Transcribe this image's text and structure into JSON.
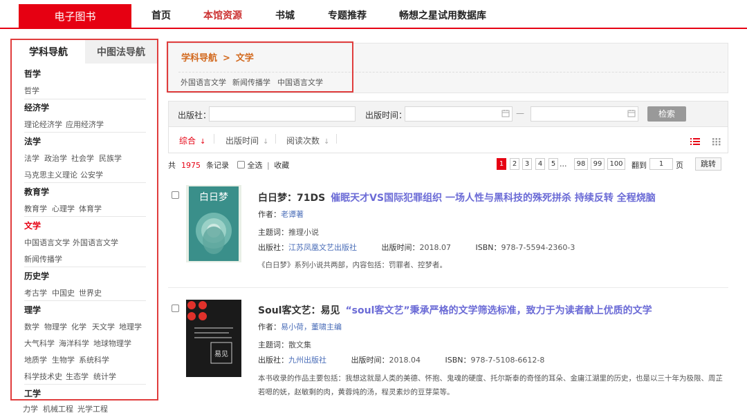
{
  "topnav": {
    "brand": "电子图书",
    "items": [
      "首页",
      "本馆资源",
      "书城",
      "专题推荐",
      "畅想之星试用数据库"
    ]
  },
  "sidebar": {
    "tabs": [
      "学科导航",
      "中图法导航"
    ],
    "categories": [
      {
        "title": "哲学",
        "subs": [
          "哲学"
        ]
      },
      {
        "title": "经济学",
        "subs": [
          "理论经济学",
          "应用经济学"
        ]
      },
      {
        "title": "法学",
        "subs": [
          "法学",
          "政治学",
          "社会学",
          "民族学",
          "马克思主义理论",
          "公安学"
        ]
      },
      {
        "title": "教育学",
        "subs": [
          "教育学",
          "心理学",
          "体育学"
        ]
      },
      {
        "title": "文学",
        "subs": [
          "中国语言文学",
          "外国语言文学",
          "新闻传播学"
        ]
      },
      {
        "title": "历史学",
        "subs": [
          "考古学",
          "中国史",
          "世界史"
        ]
      },
      {
        "title": "理学",
        "subs": [
          "数学",
          "物理学",
          "化学",
          "天文学",
          "地理学",
          "大气科学",
          "海洋科学",
          "地球物理学",
          "地质学",
          "生物学",
          "系统科学",
          "科学技术史",
          "生态学",
          "统计学"
        ]
      },
      {
        "title": "工学",
        "subs": [
          "力学",
          "机械工程",
          "光学工程"
        ]
      }
    ]
  },
  "breadcrumb": {
    "root": "学科导航",
    "arrow": ">",
    "current": "文学",
    "links": [
      "外国语言文学",
      "新闻传播学",
      "中国语言文学"
    ]
  },
  "search": {
    "publisher_label": "出版社：",
    "time_label": "出版时间：",
    "dash": "—",
    "button": "检索"
  },
  "sort": {
    "items": [
      "综合",
      "出版时间",
      "阅读次数"
    ]
  },
  "results": {
    "prefix": "共",
    "total": "1975",
    "suffix": "条记录",
    "select_all": "全选",
    "sep": "|",
    "favorite": "收藏"
  },
  "pagination": {
    "pages": [
      "1",
      "2",
      "3",
      "4",
      "5",
      "...",
      "98",
      "99",
      "100"
    ],
    "goto_label": "翻到",
    "goto_value": "1",
    "page_unit": "页",
    "jump": "跳转"
  },
  "books": [
    {
      "title": "白日梦：71DS",
      "desc": "催眠天才VS国际犯罪组织 一场人性与黑科技的殊死拼杀 持续反转 全程烧脑",
      "author_label": "作者：",
      "author": "老谭著",
      "subject_label": "主题词：",
      "subject": "推理小说",
      "publisher_label": "出版社：",
      "publisher": "江苏凤凰文艺出版社",
      "date_label": "出版时间：",
      "date": "2018.07",
      "isbn_label": "ISBN：",
      "isbn": "978-7-5594-2360-3",
      "abstract": "《白日梦》系列小说共两部，内容包括：罚罪者、控梦者。",
      "cover_text": "白日梦",
      "cover_color": "#3a8f8a"
    },
    {
      "title": "Soul客文艺：易见",
      "desc": "“soul客文艺”秉承严格的文学筛选标准，致力于为读者献上优质的文学",
      "author_label": "作者：",
      "author": "易小荷，董啸主编",
      "subject_label": "主题词：",
      "subject": "散文集",
      "publisher_label": "出版社：",
      "publisher": "九州出版社",
      "date_label": "出版时间：",
      "date": "2018.04",
      "isbn_label": "ISBN：",
      "isbn": "978-7-5108-6612-8",
      "abstract": "本书收录的作品主要包括：我想这就是人类的美德、怀抱、鬼魂的硬度、托尔斯泰的奇怪的耳朵、金庸江湖里的历史，也是以三十年为极限、周芷若嗯的妩，赵敏剩的肉，黄蓉炖的汤，程灵素炒的豆芽菜等。",
      "cover_text": "易见",
      "cover_color": "#1a1a1a"
    }
  ],
  "colors": {
    "accent": "#e60012",
    "link": "#4a6db8",
    "title_desc": "#6b6bd6"
  }
}
